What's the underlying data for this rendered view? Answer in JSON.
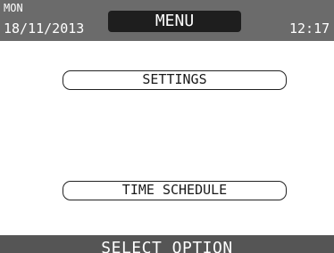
{
  "header": {
    "day": "MON",
    "date": "18/11/2013",
    "title": "MENU",
    "time": "12:17"
  },
  "menu": {
    "options": [
      {
        "label": "SETTINGS"
      },
      {
        "label": "TIME SCHEDULE"
      }
    ]
  },
  "footer": {
    "status": "SELECT OPTION"
  },
  "colors": {
    "header_bar": "#6b6b6b",
    "title_box": "#1e1e1e",
    "footer_bar": "#555555",
    "background": "#ffffff"
  }
}
